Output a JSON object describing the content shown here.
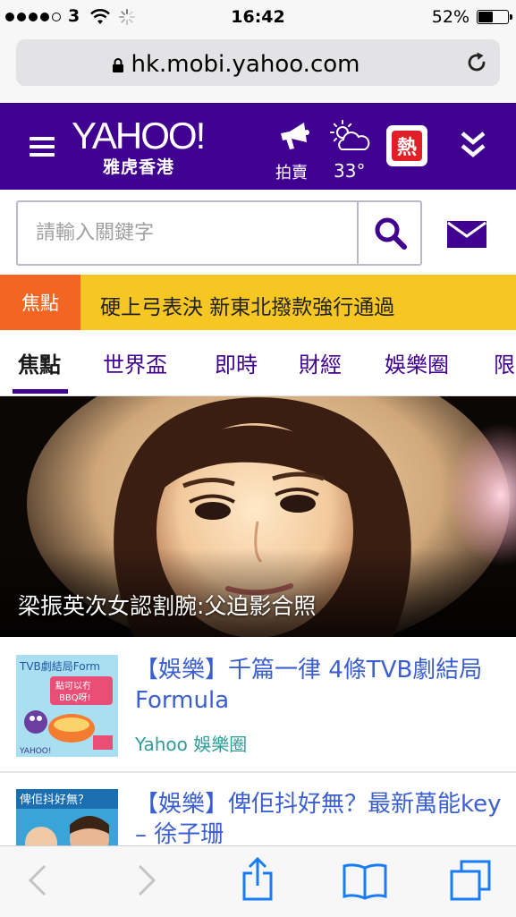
{
  "status_bar": {
    "carrier": "3",
    "time": "16:42",
    "battery": "52%",
    "battery_level": 0.52,
    "signal_dots_filled": 4,
    "signal_dots_total": 5
  },
  "address_bar": {
    "url": "hk.mobi.yahoo.com",
    "lock_icon": "lock-icon",
    "reload_icon": "reload-icon"
  },
  "header": {
    "logo_text": "YAHOO!",
    "logo_subtitle": "雅虎香港",
    "auction_label": "拍賣",
    "temperature": "33°",
    "hot_badge": "熱",
    "brand_color": "#400090"
  },
  "search": {
    "placeholder": "請輸入關鍵字"
  },
  "ticker": {
    "label": "焦點",
    "headline": "硬上弓表決 新東北撥款強行通過"
  },
  "tabs": [
    {
      "label": "焦點",
      "active": true
    },
    {
      "label": "世界盃"
    },
    {
      "label": "即時"
    },
    {
      "label": "財經"
    },
    {
      "label": "娛樂圈"
    },
    {
      "label": "限"
    }
  ],
  "hero": {
    "caption": "梁振英次女認割腕:父迫影合照"
  },
  "articles": [
    {
      "title": "【娛樂】千篇一律 4條TVB劇結局Formula",
      "source": "Yahoo 娛樂圈",
      "thumb_text": "TVB劇結局Form",
      "thumb_sub": "點可以冇 BBQ呀!"
    },
    {
      "title": "【娛樂】俾佢抖好無？最新萬能key – 徐子珊",
      "thumb_text": "俾佢抖好無？"
    }
  ],
  "toolbar": {
    "back_icon": "back-icon",
    "forward_icon": "forward-icon",
    "share_icon": "share-icon",
    "bookmarks_icon": "bookmarks-icon",
    "tabs_icon": "tabs-icon"
  }
}
